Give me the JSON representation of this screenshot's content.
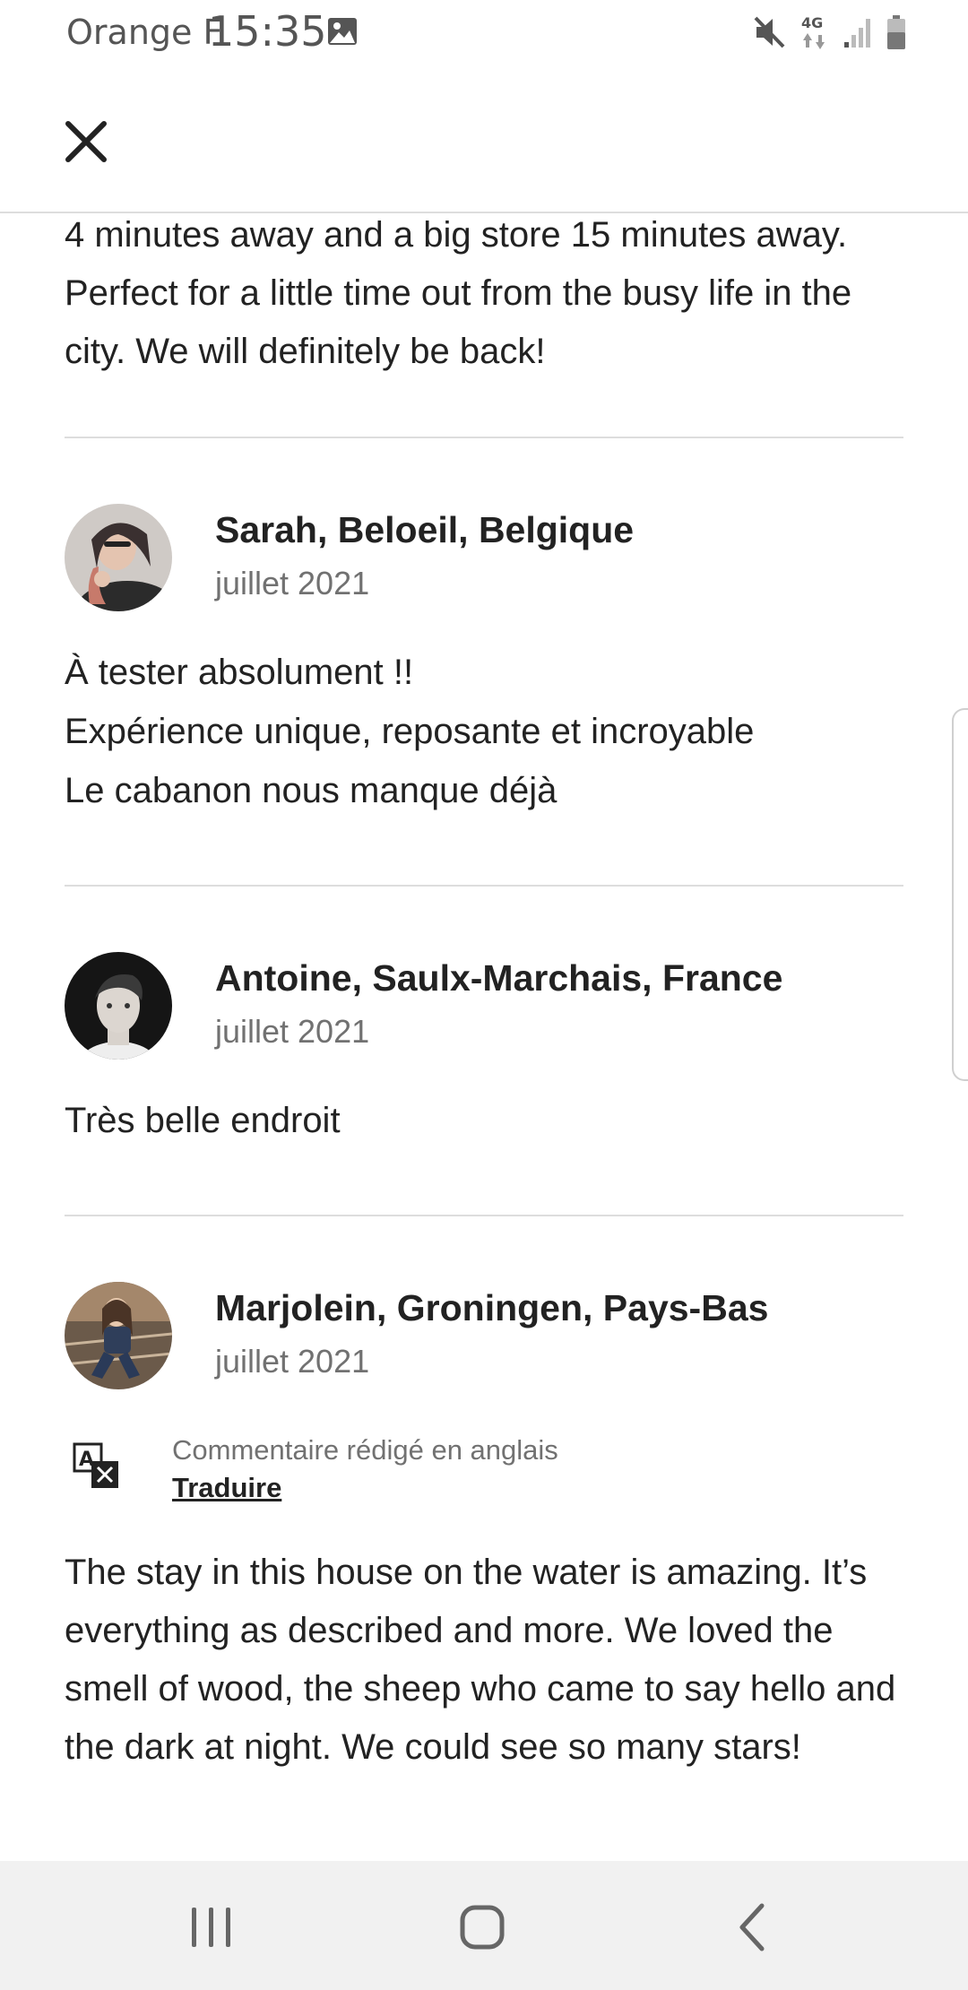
{
  "status_bar": {
    "carrier": "Orange F",
    "time": "15:35",
    "icons": [
      "image-icon",
      "mute-icon",
      "4g-data-icon",
      "signal-icon",
      "battery-icon"
    ],
    "network_label": "4G"
  },
  "header": {
    "close_icon": "close-icon"
  },
  "intro_text": "4 minutes away and a big store 15 minutes away. Perfect for a little time out from the busy life in the city. We will definitely be back!",
  "reviews": [
    {
      "name": "Sarah, Beloeil, Belgique",
      "date": "juillet 2021",
      "lines": [
        "À tester absolument !!",
        "Expérience unique, reposante et incroyable",
        "Le cabanon nous manque déjà"
      ]
    },
    {
      "name": "Antoine, Saulx-Marchais, France",
      "date": "juillet 2021",
      "lines": [
        "Très belle endroit"
      ]
    },
    {
      "name": "Marjolein, Groningen, Pays-Bas",
      "date": "juillet 2021",
      "translation_note": "Commentaire rédigé en anglais",
      "translate_label": "Traduire",
      "text": "The stay in this house on the water is amazing. It’s everything as described and more. We loved the smell of wood, the sheep who came to say hello and the dark at night. We could see so many stars!"
    }
  ],
  "nav_bar": {
    "icons": [
      "recent-apps-icon",
      "home-icon",
      "back-icon"
    ]
  }
}
